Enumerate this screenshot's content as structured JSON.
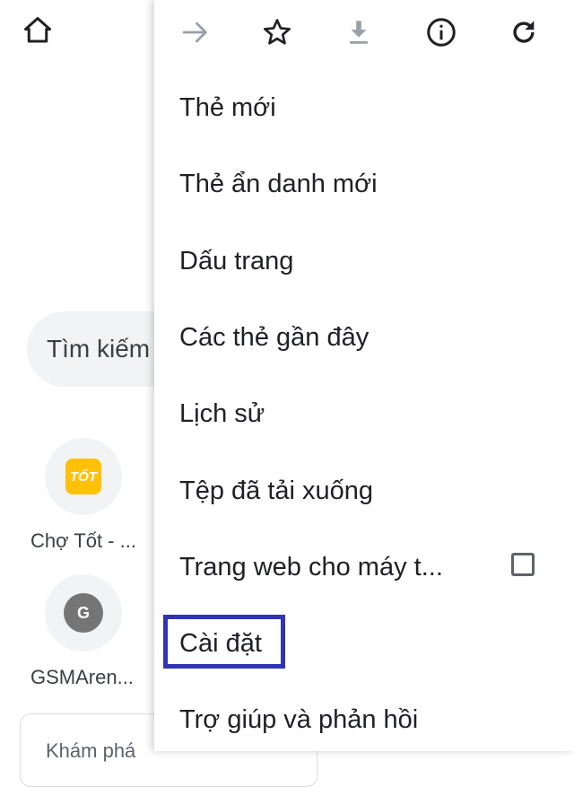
{
  "background": {
    "search_placeholder": "Tìm kiếm",
    "tiles": [
      {
        "label": "Chợ Tốt - ...",
        "logo_text": "TỐT"
      },
      {
        "label": "GSMAren...",
        "logo_text": "G"
      }
    ],
    "explore_label": "Khám phá"
  },
  "menu": {
    "toolbar": [
      {
        "name": "forward-icon",
        "enabled": false
      },
      {
        "name": "star-icon",
        "enabled": true
      },
      {
        "name": "download-icon",
        "enabled": false
      },
      {
        "name": "info-icon",
        "enabled": true
      },
      {
        "name": "reload-icon",
        "enabled": true
      }
    ],
    "items": [
      {
        "label": "Thẻ mới"
      },
      {
        "label": "Thẻ ẩn danh mới"
      },
      {
        "label": "Dấu trang"
      },
      {
        "label": "Các thẻ gần đây"
      },
      {
        "label": "Lịch sử"
      },
      {
        "label": "Tệp đã tải xuống"
      },
      {
        "label": "Trang web cho máy t...",
        "checkbox": false
      },
      {
        "label": "Cài đặt",
        "highlighted": true
      },
      {
        "label": "Trợ giúp và phản hồi"
      }
    ]
  },
  "colors": {
    "highlight_border": "#2f35b5",
    "icon_active": "#202124",
    "icon_disabled": "#9aa0a6",
    "tot_logo": "#ffc107"
  }
}
